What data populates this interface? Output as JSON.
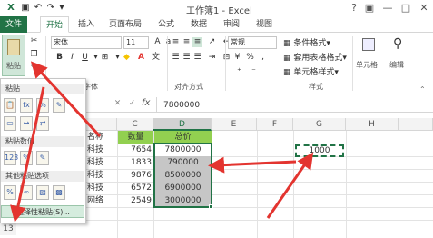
{
  "window": {
    "title": "工作簿1 - Excel",
    "help": "?",
    "controls": [
      "▣",
      "—",
      "□",
      "✕"
    ]
  },
  "tabs": [
    "文件",
    "开始",
    "插入",
    "页面布局",
    "公式",
    "数据",
    "审阅",
    "视图"
  ],
  "ribbon": {
    "paste_label": "粘贴",
    "font_name": "宋体",
    "font_size": "11",
    "font_group_label": "字体",
    "align_group_label": "对齐方式",
    "number_format": "常规",
    "number_symbols": [
      "%",
      ","
    ],
    "style_items": [
      "条件格式",
      "套用表格格式",
      "单元格样式"
    ],
    "style_group_label": "样式",
    "cells_label": "单元格",
    "edit_label": "编辑"
  },
  "formula_bar": {
    "fx": "fx",
    "value": "7800000"
  },
  "paste_menu": {
    "sections": [
      "粘贴",
      "粘贴数值",
      "其他粘贴选项"
    ],
    "special": "选择性粘贴(S)..."
  },
  "grid": {
    "columns": [
      "C",
      "D",
      "E",
      "F",
      "G",
      "H"
    ],
    "rows": [
      {
        "b": "名称",
        "c": "数量",
        "d": "总价"
      },
      {
        "b": "科技",
        "c": "7654",
        "d": "7800000"
      },
      {
        "b": "科技",
        "c": "1833",
        "d": "790000"
      },
      {
        "b": "科技",
        "c": "9876",
        "d": "8500000"
      },
      {
        "b": "科技",
        "c": "6572",
        "d": "6900000"
      },
      {
        "b": "网络",
        "c": "2549",
        "d": "3000000"
      }
    ],
    "g_value": "1000",
    "row_number": "13",
    "accent": "#217346",
    "header_fill": "#92d050",
    "selection_fill": "#c6c6c6"
  }
}
